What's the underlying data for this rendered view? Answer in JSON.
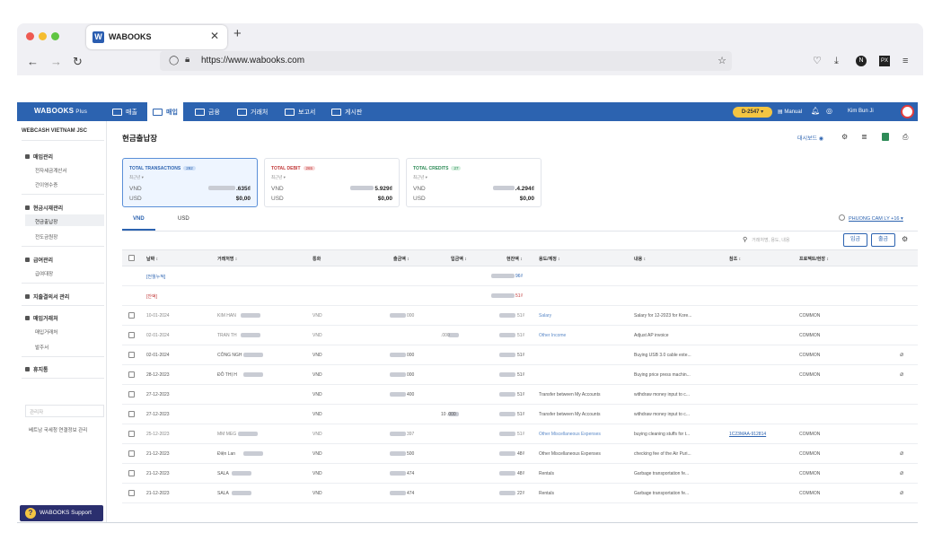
{
  "browser": {
    "tab_title": "WABOOKS",
    "tab_logo": "W",
    "url": "https://www.wabooks.com",
    "icons": [
      "back-icon",
      "forward-icon",
      "reload-icon",
      "shield-icon",
      "lock-icon",
      "bookmark-star-icon",
      "pocket-icon",
      "download-icon",
      "account-icon",
      "extension-icon",
      "menu-icon"
    ]
  },
  "app": {
    "brand": "WABOOKS",
    "brand_suffix": "Plus",
    "nav": [
      {
        "label": "매출"
      },
      {
        "label": "매입"
      },
      {
        "label": "금융"
      },
      {
        "label": "거래처"
      },
      {
        "label": "보고서"
      },
      {
        "label": "게시판"
      }
    ],
    "active_nav": "매입",
    "d_badge": "D-2547",
    "manual": "Manual",
    "user_name": "Kim Bun Ji"
  },
  "sidebar": {
    "company": "WEBCASH VIETNAM JSC",
    "groups": [
      {
        "label": "매입관리",
        "items": [
          "전자세금계산서",
          "간이영수증"
        ]
      },
      {
        "label": "현금시재관리",
        "items": [
          "현금출납장",
          "전도금원장"
        ]
      },
      {
        "label": "급여관리",
        "items": [
          "급여대장"
        ]
      },
      {
        "label": "지출결의서 관리",
        "items": []
      },
      {
        "label": "매입거래처",
        "items": [
          "매입거래처",
          "발주서"
        ]
      },
      {
        "label": "휴지통",
        "items": []
      }
    ],
    "active_item": "현금출납장",
    "search_placeholder": "관리자",
    "link": "베트남 국세청 연결정보 관리",
    "support": "WABOOKS Support"
  },
  "main": {
    "title": "현금출납장",
    "dashboard_label": "대시보드",
    "cards": [
      {
        "title": "TOTAL TRANSACTIONS",
        "badge": "292",
        "sub": "최근년 ▾",
        "vnd_label": "VND",
        "vnd_value": ".635₫",
        "usd_label": "USD",
        "usd_value": "$0,00"
      },
      {
        "title": "TOTAL DEBIT",
        "badge": "265",
        "sub": "최근년 ▾",
        "vnd_label": "VND",
        "vnd_value": "5.929₫",
        "usd_label": "USD",
        "usd_value": "$0,00"
      },
      {
        "title": "TOTAL CREDITS",
        "badge": "27",
        "sub": "최근년 ▾",
        "vnd_label": "VND",
        "vnd_value": ".4.294₫",
        "usd_label": "USD",
        "usd_value": "$0,00"
      }
    ],
    "currency_tabs": [
      "VND",
      "USD"
    ],
    "active_currency_tab": "VND",
    "user_filter": "PHUONG CAM LY +16",
    "search_placeholder": "거래처명, 용도, 내용",
    "btn_in": "입금",
    "btn_out": "출금",
    "columns": [
      "날짜 ↕",
      "거래처명 ↕",
      "통화",
      "출금액 ↕",
      "입금액 ↕",
      "현잔액 ↕",
      "용도/계정 ↕",
      "내용 ↕",
      "참조 ↕",
      "프로젝트/현장 ↕"
    ],
    "summary_rows": [
      {
        "label": "[전월누적]",
        "balance": "96₫",
        "style": "link"
      },
      {
        "label": "[잔액]",
        "balance": "51₫",
        "style": "red"
      }
    ],
    "rows": [
      {
        "date": "10-01-2024",
        "vendor": "KIM HAN",
        "currency": "VND",
        "debit": "000",
        "credit": "",
        "balance": "51₫",
        "category": "Salary",
        "content": "Salary for 12-2023 for Kore...",
        "ref": "",
        "project": "COMMON",
        "attach": false,
        "dim": true
      },
      {
        "date": "02-01-2024",
        "vendor": "TRAN TH",
        "currency": "VND",
        "debit": "",
        "credit": ".000",
        "balance": "51₫",
        "category": "Other Income",
        "content": "Adjust AP invoice",
        "ref": "",
        "project": "COMMON",
        "attach": false,
        "dim": true
      },
      {
        "date": "02-01-2024",
        "vendor": "CÔNG NGH",
        "currency": "VND",
        "debit": "000",
        "credit": "",
        "balance": "51₫",
        "category": "",
        "content": "Buying USB 3.0 cable exte...",
        "ref": "",
        "project": "COMMON",
        "attach": true,
        "dim": false
      },
      {
        "date": "28-12-2023",
        "vendor": "ĐỖ THỊ H",
        "currency": "VND",
        "debit": "000",
        "credit": "",
        "balance": "51₫",
        "category": "",
        "content": "Buying price press machin...",
        "ref": "",
        "project": "COMMON",
        "attach": true,
        "dim": false
      },
      {
        "date": "27-12-2023",
        "vendor": "",
        "currency": "VND",
        "debit": "400",
        "credit": "",
        "balance": "51₫",
        "category": "Transfer between My Accounts",
        "content": "withdraw money input to c...",
        "ref": "",
        "project": "",
        "attach": false,
        "dim": false
      },
      {
        "date": "27-12-2023",
        "vendor": "",
        "currency": "VND",
        "debit": "",
        "credit": "10 .000",
        "balance": "51₫",
        "category": "Transfer between My Accounts",
        "content": "withdraw money input to c...",
        "ref": "",
        "project": "",
        "attach": false,
        "dim": false
      },
      {
        "date": "25-12-2023",
        "vendor": "MM MEG",
        "currency": "VND",
        "debit": "397",
        "credit": "",
        "balance": "51₫",
        "category": "Other Miscellaneous Expenses",
        "content": "buying cleaning stuffs for t...",
        "ref": "1C23MAA-912814",
        "project": "COMMON",
        "attach": false,
        "dim": true
      },
      {
        "date": "21-12-2023",
        "vendor": "Điện Lan",
        "currency": "VND",
        "debit": "500",
        "credit": "",
        "balance": "48₫",
        "category": "Other Miscellaneous Expenses",
        "content": "checking fee of the Air Puri...",
        "ref": "",
        "project": "COMMON",
        "attach": true,
        "dim": false
      },
      {
        "date": "21-12-2023",
        "vendor": "SALA",
        "currency": "VND",
        "debit": "474",
        "credit": "",
        "balance": "48₫",
        "category": "Rentals",
        "content": "Garbage transportation fe...",
        "ref": "",
        "project": "COMMON",
        "attach": true,
        "dim": false
      },
      {
        "date": "21-12-2023",
        "vendor": "SALA",
        "currency": "VND",
        "debit": "474",
        "credit": "",
        "balance": "22₫",
        "category": "Rentals",
        "content": "Garbage transportation fe...",
        "ref": "",
        "project": "COMMON",
        "attach": true,
        "dim": false
      }
    ]
  },
  "colors": {
    "primary": "#2c63b0",
    "badge_yellow": "#f4c542",
    "support_bg": "#2b2f6e",
    "debit_red": "#c23a3a",
    "credit_green": "#2e8b57"
  }
}
